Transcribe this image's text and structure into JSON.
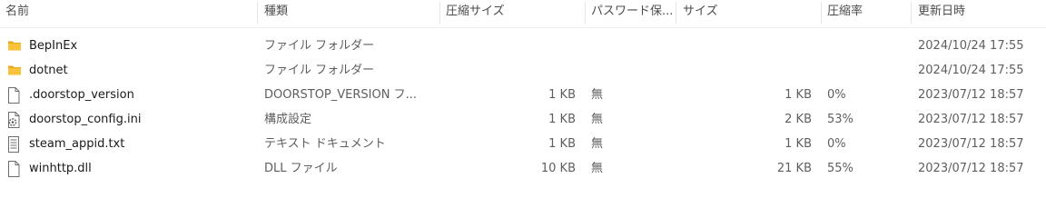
{
  "columns": {
    "name": "名前",
    "type": "種類",
    "compressed_size": "圧縮サイズ",
    "password_protected": "パスワード保...",
    "size": "サイズ",
    "ratio": "圧縮率",
    "modified": "更新日時"
  },
  "rows": [
    {
      "name": "BepInEx",
      "icon": "folder-icon",
      "type": "ファイル フォルダー",
      "compressed_size": "",
      "password_protected": "",
      "size": "",
      "ratio": "",
      "modified": "2024/10/24 17:55"
    },
    {
      "name": "dotnet",
      "icon": "folder-icon",
      "type": "ファイル フォルダー",
      "compressed_size": "",
      "password_protected": "",
      "size": "",
      "ratio": "",
      "modified": "2024/10/24 17:55"
    },
    {
      "name": ".doorstop_version",
      "icon": "file-icon",
      "type": "DOORSTOP_VERSION フ...",
      "compressed_size": "1 KB",
      "password_protected": "無",
      "size": "1 KB",
      "ratio": "0%",
      "modified": "2023/07/12 18:57"
    },
    {
      "name": "doorstop_config.ini",
      "icon": "config-file-icon",
      "type": "構成設定",
      "compressed_size": "1 KB",
      "password_protected": "無",
      "size": "2 KB",
      "ratio": "53%",
      "modified": "2023/07/12 18:57"
    },
    {
      "name": "steam_appid.txt",
      "icon": "text-file-icon",
      "type": "テキスト ドキュメント",
      "compressed_size": "1 KB",
      "password_protected": "無",
      "size": "1 KB",
      "ratio": "0%",
      "modified": "2023/07/12 18:57"
    },
    {
      "name": "winhttp.dll",
      "icon": "file-icon",
      "type": "DLL ファイル",
      "compressed_size": "10 KB",
      "password_protected": "無",
      "size": "21 KB",
      "ratio": "55%",
      "modified": "2023/07/12 18:57"
    }
  ],
  "colors": {
    "folder": "#f8c33a",
    "folder_dark": "#e8a917"
  }
}
